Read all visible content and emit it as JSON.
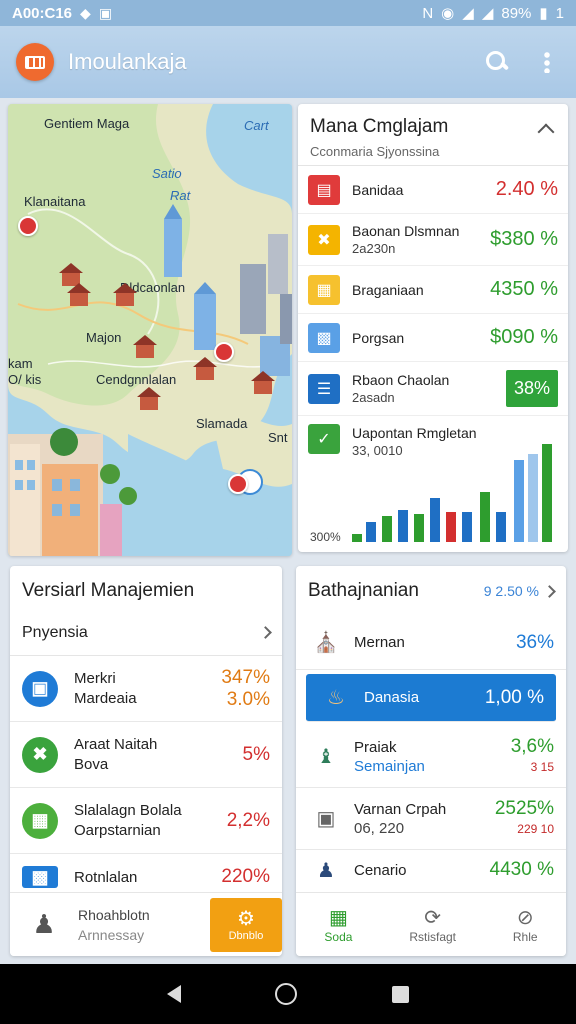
{
  "status_bar": {
    "time": "A00:C16",
    "battery": "89%",
    "sim": "1"
  },
  "app_bar": {
    "title": "Imoulankaja",
    "icons": [
      "app-logo-icon",
      "search-icon",
      "more-vert-icon"
    ]
  },
  "map": {
    "title": "Gentiem Maga",
    "cart_label": "Cart",
    "labels": {
      "satio": "Satio",
      "rat": "Rat",
      "klanaitana": "Klanaitana",
      "dldcaonlan": "Dldcaonlan",
      "majon": "Majon",
      "kam": "kam",
      "orkis": "O/ kis",
      "cendgnnlalan": "Cendgnnlalan",
      "slamada": "Slamada",
      "snt": "Snt"
    }
  },
  "mana": {
    "title": "Mana Cmglajam",
    "subtitle": "Cconmaria Sjyonssina",
    "rows": [
      {
        "label": "Banidaa",
        "sub": "",
        "value": "2.40 %",
        "color": "#d32f2f",
        "icon": "report-icon"
      },
      {
        "label": "Baonan Dlsmnan",
        "sub": "2a230n",
        "value": "$380 %",
        "color": "#2e9d2e",
        "icon": "tools-icon"
      },
      {
        "label": "Braganiaan",
        "sub": "",
        "value": "4350 %",
        "color": "#2e9d2e",
        "icon": "calendar-icon"
      },
      {
        "label": "Porgsan",
        "sub": "",
        "value": "$090 %",
        "color": "#2e9d2e",
        "icon": "building-icon"
      },
      {
        "label": "Rbaon Chaolan",
        "sub": "2asadn",
        "value": "38%",
        "color": "#2fa33a",
        "icon": "document-icon"
      },
      {
        "label": "Uapontan Rmgletan",
        "sub": "33, 0010",
        "value": "",
        "color": "",
        "icon": "check-icon"
      }
    ],
    "chart_label": "300%"
  },
  "management": {
    "title": "Versiarl Manajemien",
    "subtitle": "Pnyensia",
    "rows": [
      {
        "label": "Merkri",
        "sub": "Mardeaia",
        "value": "347%",
        "value2": "3.0%",
        "color": "#e07b14",
        "icon_color": "#1f7bd6",
        "icon": "bus-icon"
      },
      {
        "label": "Araat Naitah",
        "sub": "Bova",
        "value": "5%",
        "value2": "",
        "color": "#d32f2f",
        "icon_color": "#3aa33d",
        "icon": "tools-circle-icon"
      },
      {
        "label": "Slalalagn Bolala",
        "sub": "Oarpstarnian",
        "value": "2,2%",
        "value2": "",
        "color": "#d32f2f",
        "icon_color": "#4caf3c",
        "icon": "calendar-circle-icon"
      },
      {
        "label": "Rotnlalan",
        "sub": "",
        "value": "220%",
        "value2": "",
        "color": "#d32f2f",
        "icon_color": "#1f7bd6",
        "icon": "shop-icon"
      }
    ],
    "footer": {
      "label": "Rhoahblotn",
      "sub": "Arnnessay",
      "button": "Dbnblo"
    }
  },
  "bath": {
    "title": "Bathajnanian",
    "header_value": "9 2.50 %",
    "rows": [
      {
        "label": "Mernan",
        "sub": "",
        "value": "36%",
        "small": "",
        "color": "#1f7bd6",
        "icon": "temple-icon"
      },
      {
        "label": "Danasia",
        "sub": "",
        "value": "1,00 %",
        "small": "",
        "color": "#ffffff",
        "icon": "lantern-icon",
        "selected": true
      },
      {
        "label": "Praiak",
        "sub": "Semainjan",
        "value": "3,6%",
        "small": "3 15",
        "color": "#2e9d2e",
        "icon": "tower-icon"
      },
      {
        "label": "Varnan Crpah",
        "sub": "06, 220",
        "value": "2525%",
        "small": " 229 10",
        "color": "#2e9d2e",
        "icon": "gate-icon"
      },
      {
        "label": "Cenario",
        "sub": "",
        "value": "4430 %",
        "small": "",
        "color": "#2e9d2e",
        "icon": "person-icon"
      }
    ],
    "footer": [
      {
        "label": "Soda",
        "icon": "grid-icon",
        "active": true
      },
      {
        "label": "Rstisfagt",
        "icon": "refresh-icon",
        "active": false
      },
      {
        "label": "Rhle",
        "icon": "block-icon",
        "active": false
      }
    ]
  }
}
